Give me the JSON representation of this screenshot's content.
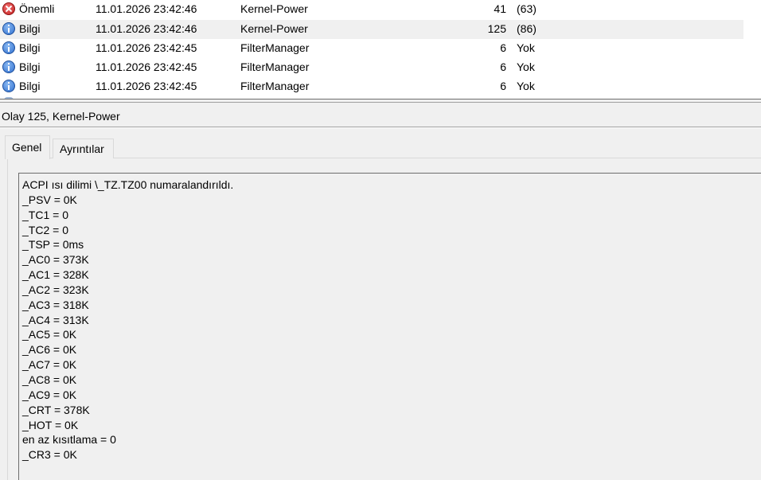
{
  "events": [
    {
      "level": "Önemli",
      "level_icon": "error-icon",
      "date": "11.01.2026 23:42:46",
      "source": "Kernel-Power",
      "event_id": "41",
      "task": "(63)",
      "selected": false
    },
    {
      "level": "Bilgi",
      "level_icon": "info-icon",
      "date": "11.01.2026 23:42:46",
      "source": "Kernel-Power",
      "event_id": "125",
      "task": "(86)",
      "selected": true
    },
    {
      "level": "Bilgi",
      "level_icon": "info-icon",
      "date": "11.01.2026 23:42:45",
      "source": "FilterManager",
      "event_id": "6",
      "task": "Yok",
      "selected": false
    },
    {
      "level": "Bilgi",
      "level_icon": "info-icon",
      "date": "11.01.2026 23:42:45",
      "source": "FilterManager",
      "event_id": "6",
      "task": "Yok",
      "selected": false
    },
    {
      "level": "Bilgi",
      "level_icon": "info-icon",
      "date": "11.01.2026 23:42:45",
      "source": "FilterManager",
      "event_id": "6",
      "task": "Yok",
      "selected": false
    }
  ],
  "detail": {
    "title": "Olay 125, Kernel-Power",
    "tabs": [
      "Genel",
      "Ayrıntılar"
    ],
    "active_tab": "Genel",
    "message_lines": [
      "ACPI ısı dilimi \\_TZ.TZ00 numaralandırıldı.",
      "_PSV = 0K",
      "_TC1 = 0",
      "_TC2 = 0",
      "_TSP = 0ms",
      "_AC0 = 373K",
      "_AC1 = 328K",
      "_AC2 = 323K",
      "_AC3 = 318K",
      "_AC4 = 313K",
      "_AC5 = 0K",
      "_AC6 = 0K",
      "_AC7 = 0K",
      "_AC8 = 0K",
      "_AC9 = 0K",
      "_CRT = 378K",
      "_HOT = 0K",
      "en az kısıtlama = 0",
      "_CR3 = 0K"
    ]
  },
  "colors": {
    "selected_row": "#f0f0f0",
    "pane_bg": "#f0f0f0",
    "error_icon": "#c42020",
    "info_icon": "#2f6fcf"
  }
}
